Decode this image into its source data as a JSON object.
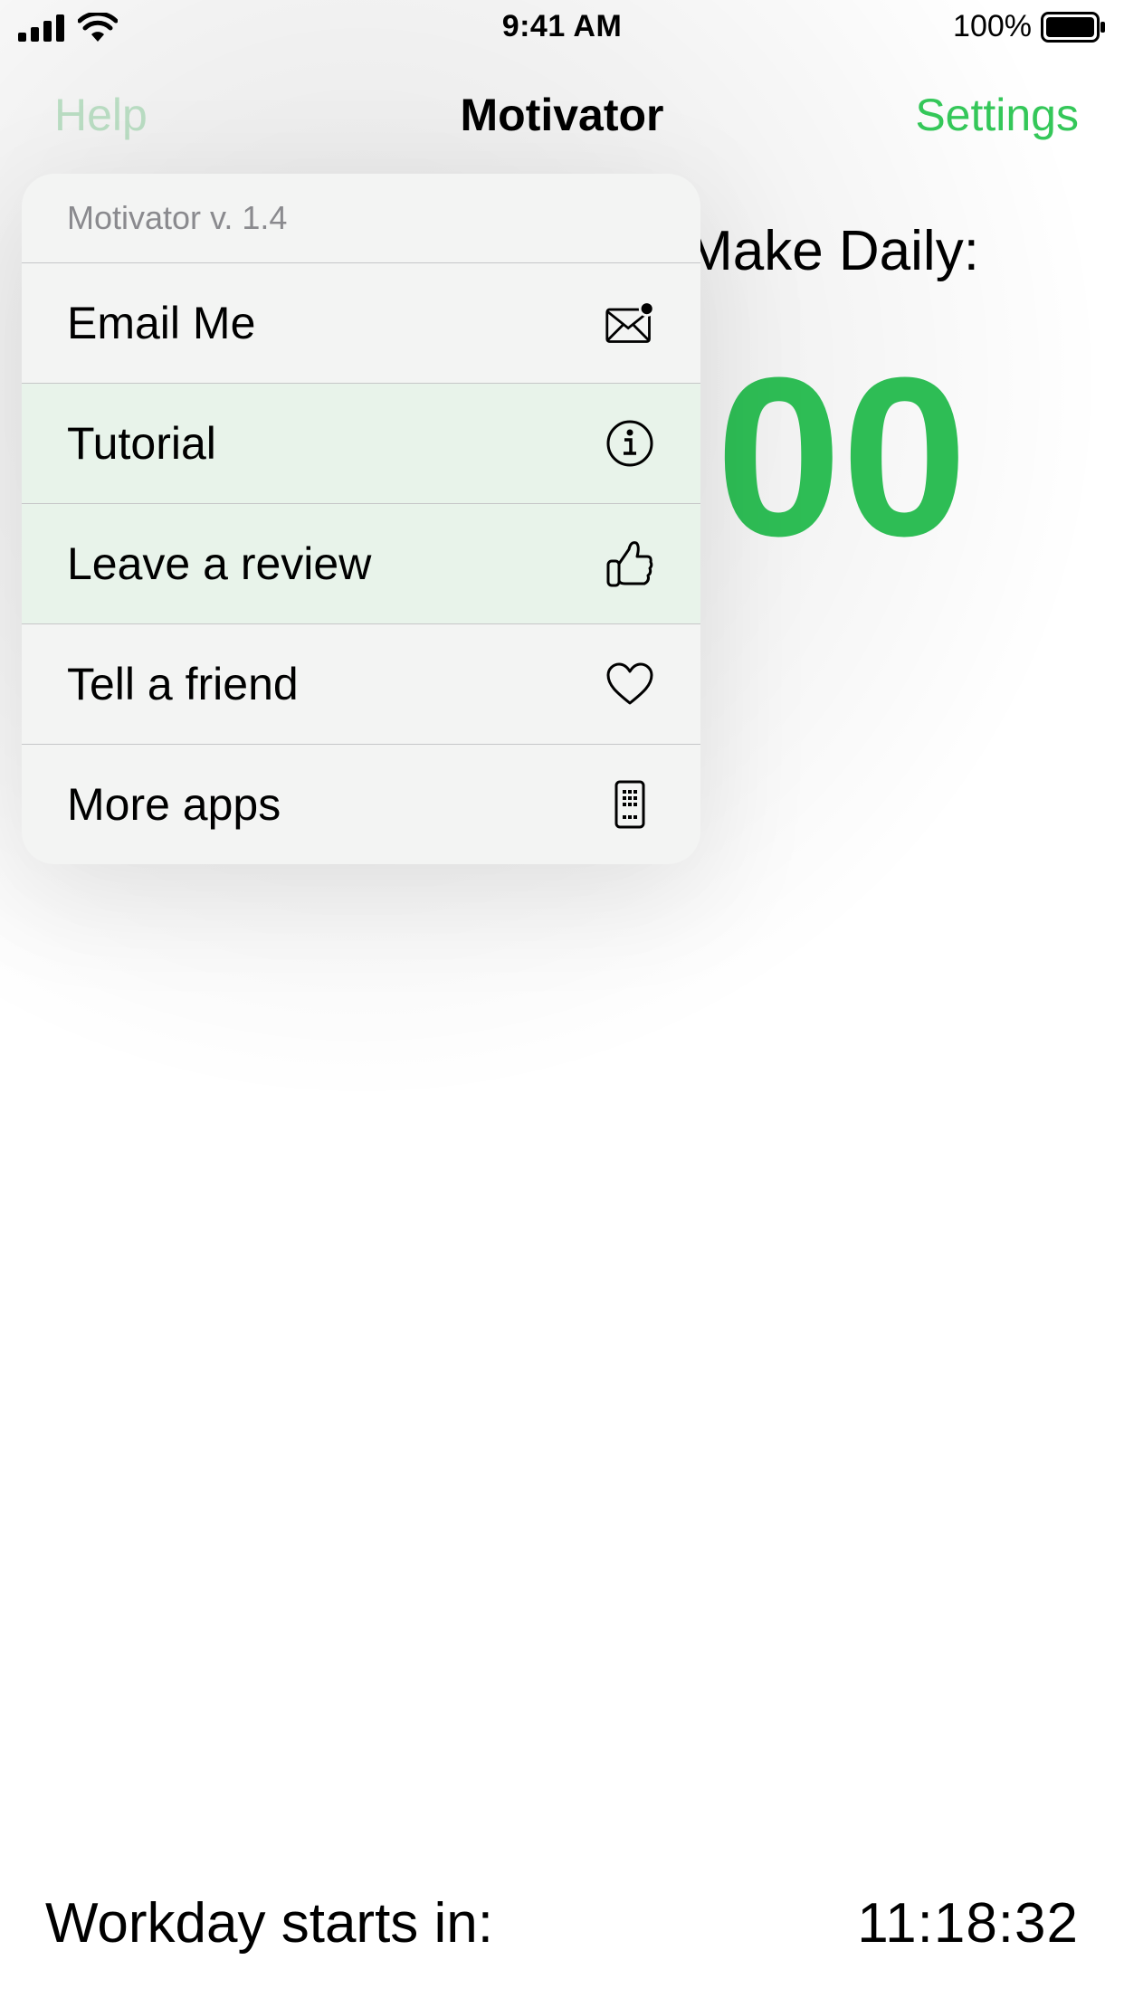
{
  "status_bar": {
    "time": "9:41 AM",
    "battery_percent": "100%",
    "signal_icon": "cellular-signal-icon",
    "wifi_icon": "wifi-icon",
    "battery_icon": "battery-icon"
  },
  "nav": {
    "left": "Help",
    "title": "Motivator",
    "right": "Settings"
  },
  "main": {
    "daily_label": "Make Daily:",
    "daily_value": "00"
  },
  "menu": {
    "header": "Motivator v. 1.4",
    "items": [
      {
        "label": "Email Me",
        "icon": "envelope-badge-icon"
      },
      {
        "label": "Tutorial",
        "icon": "info-circle-icon"
      },
      {
        "label": "Leave a review",
        "icon": "thumbs-up-icon"
      },
      {
        "label": "Tell a friend",
        "icon": "heart-icon"
      },
      {
        "label": "More apps",
        "icon": "phone-apps-icon"
      }
    ]
  },
  "footer": {
    "label": "Workday starts in:",
    "countdown": "11:18:32"
  },
  "colors": {
    "accent": "#34c759",
    "accent_faded": "#b9dcc2",
    "value": "#2ebd55"
  }
}
